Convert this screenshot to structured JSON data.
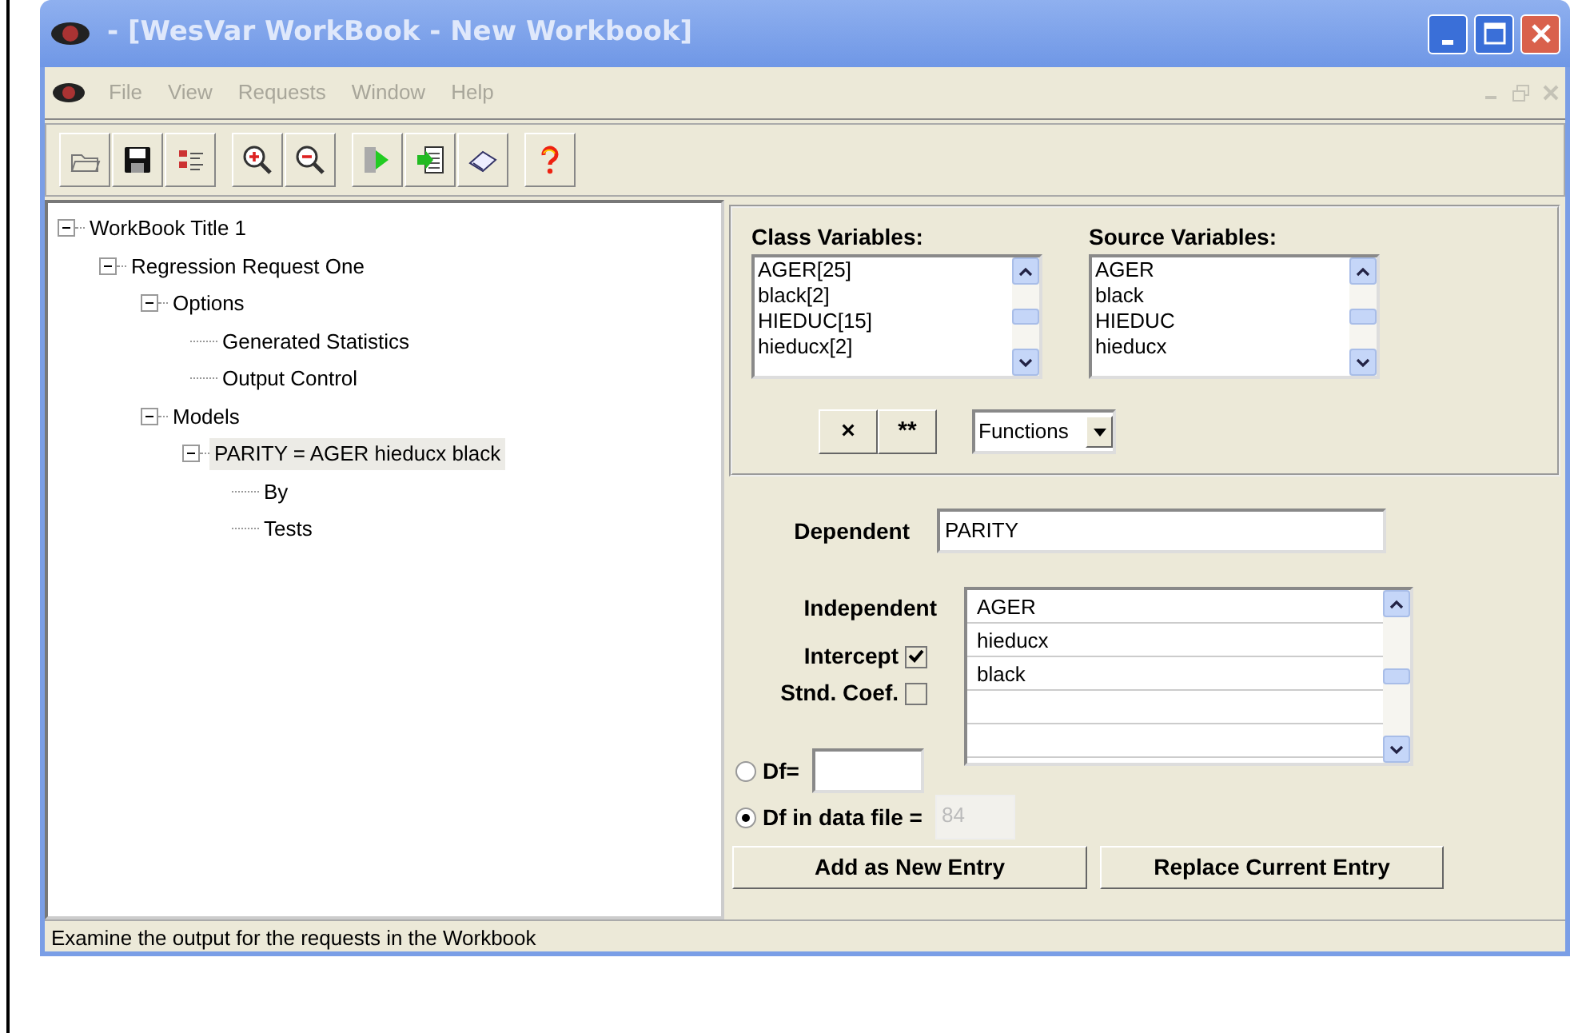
{
  "window": {
    "title": "- [WesVar WorkBook - New Workbook]"
  },
  "menu": [
    {
      "label": "File",
      "disabled": true
    },
    {
      "label": "View",
      "disabled": true
    },
    {
      "label": "Requests",
      "disabled": true
    },
    {
      "label": "Window",
      "disabled": true
    },
    {
      "label": "Help",
      "disabled": true
    }
  ],
  "tree": [
    {
      "label": "WorkBook Title 1",
      "expanded": true,
      "selected": false,
      "children": [
        {
          "label": "Regression Request One",
          "expanded": true,
          "selected": false,
          "children": [
            {
              "label": "Options",
              "expanded": true,
              "selected": false,
              "children": [
                {
                  "label": "Generated Statistics",
                  "selected": false
                },
                {
                  "label": "Output Control",
                  "selected": false
                }
              ]
            },
            {
              "label": "Models",
              "expanded": true,
              "selected": false,
              "children": [
                {
                  "label": "PARITY = AGER hieducx black",
                  "expanded": true,
                  "selected": true,
                  "children": [
                    {
                      "label": "By",
                      "selected": false
                    },
                    {
                      "label": "Tests",
                      "selected": false
                    }
                  ]
                }
              ]
            }
          ]
        }
      ]
    }
  ],
  "class_variables": {
    "label": "Class Variables:",
    "items": [
      "AGER[25]",
      "black[2]",
      "HIEDUC[15]",
      "hieducx[2]"
    ]
  },
  "source_variables": {
    "label": "Source Variables:",
    "items": [
      "AGER",
      "black",
      "HIEDUC",
      "hieducx"
    ]
  },
  "operator_buttons": [
    "×",
    "**"
  ],
  "functions_dropdown": {
    "value": "Functions"
  },
  "dependent": {
    "label": "Dependent",
    "value": "PARITY"
  },
  "independent": {
    "label": "Independent",
    "items": [
      "AGER",
      "hieducx",
      "black"
    ]
  },
  "checkboxes": [
    {
      "label": "Intercept",
      "checked": true
    },
    {
      "label": "Stnd. Coef.",
      "checked": false
    }
  ],
  "df_options": [
    {
      "label": "Df=",
      "selected": false,
      "disabled": false
    },
    {
      "label": "Df in data file =",
      "selected": true,
      "value": "84",
      "disabled": true
    }
  ],
  "buttons": [
    "Add as New Entry",
    "Replace Current Entry"
  ],
  "status_bar": "Examine the output for the requests in the Workbook"
}
